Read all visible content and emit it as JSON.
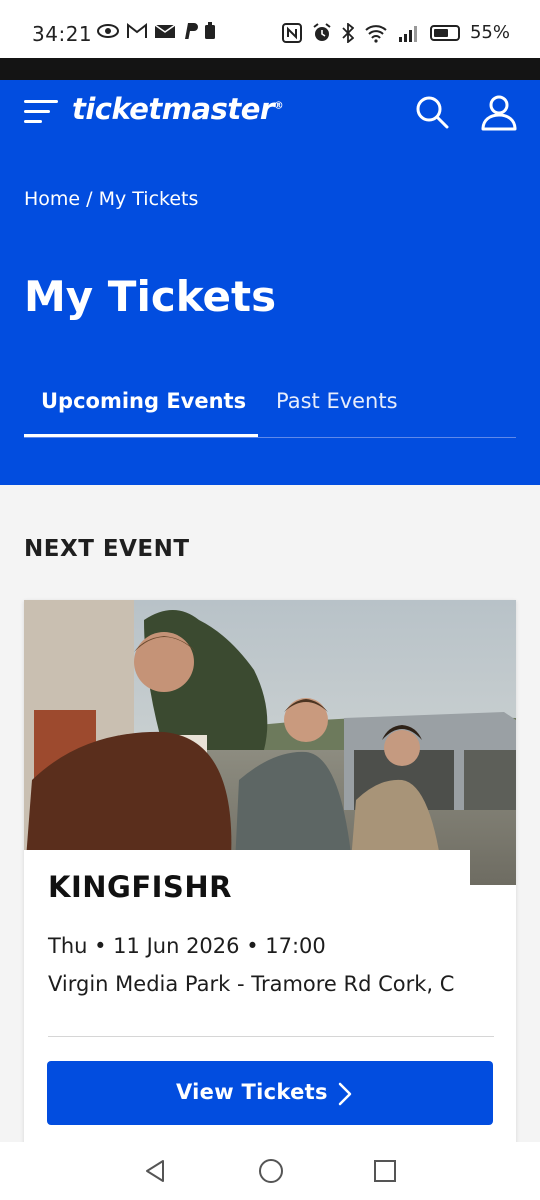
{
  "status_bar": {
    "time": "34:21",
    "notification_icons": [
      "eye-icon",
      "gmail-icon",
      "mail-icon",
      "paypal-icon",
      "battery-saver-icon"
    ],
    "system_icons": [
      "nfc-icon",
      "alarm-icon",
      "bluetooth-icon",
      "wifi-icon",
      "signal-icon"
    ],
    "battery_level": "55%"
  },
  "header": {
    "logo_text": "ticketmaster",
    "logo_mark": "®",
    "bg_color": "#024ddf",
    "breadcrumb": {
      "home": "Home",
      "separator": " / ",
      "current": "My Tickets"
    },
    "page_title": "My Tickets",
    "tabs": [
      {
        "label": "Upcoming Events",
        "active": true
      },
      {
        "label": "Past Events",
        "active": false
      }
    ]
  },
  "main": {
    "section_title": "NEXT EVENT",
    "event": {
      "artist": "KINGFISHR",
      "date_line": "Thu • 11 Jun 2026 • 17:00",
      "venue": "Virgin Media Park - Tramore Rd Cork, C",
      "button_label": "View Tickets"
    }
  },
  "nav_bar": {
    "icons": [
      "back-icon",
      "home-icon",
      "recents-icon"
    ]
  }
}
